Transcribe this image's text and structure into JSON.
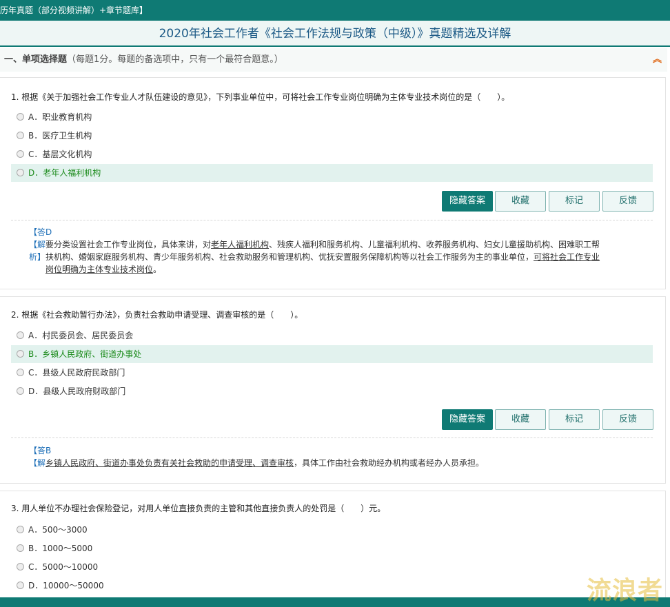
{
  "topbar": {
    "label": "历年真题（部分视频讲解）+章节题库】"
  },
  "page": {
    "title": "2020年社会工作者《社会工作法规与政策（中级）》真题精选及详解"
  },
  "section": {
    "title": "一、单项选择题",
    "desc": "（每题1分。每题的备选项中，只有一个最符合题意。）",
    "collapse_icon": "double-chevron-up-icon",
    "collapse_glyph": "︽"
  },
  "buttons": {
    "hide_answer": "隐藏答案",
    "favorite": "收藏",
    "mark": "标记",
    "feedback": "反馈"
  },
  "questions": [
    {
      "text": "1. 根据《关于加强社会工作专业人才队伍建设的意见》，下列事业单位中，可将社会工作专业岗位明确为主体专业技术岗位的是（　　）。",
      "options": [
        {
          "label": "A．职业教育机构"
        },
        {
          "label": "B．医疗卫生机构"
        },
        {
          "label": "C．基层文化机构"
        },
        {
          "label": "D．老年人福利机构"
        }
      ],
      "answer_label": "【答D",
      "explain_prefix": "【解",
      "explain_line1_a": "要分类设置社会工作专业岗位，具体来讲，对",
      "explain_line1_u": "老年人福利机构",
      "explain_line1_b": "、残疾人福利和服务机构、儿童福利机构、收养服务机构、妇女儿童援助机构、困难职工帮",
      "explain_line2_prefix": "析】",
      "explain_line2_a": "扶机构、婚姻家庭服务机构、青少年服务机构、社会救助服务和管理机构、优抚安置服务保障机构等以社会工作服务为主的事业单位，",
      "explain_line2_u": "可将社会工作专业",
      "explain_line3_u": "岗位明确为主体专业技术岗位",
      "explain_line3_b": "。"
    },
    {
      "text": "2. 根据《社会救助暂行办法》，负责社会救助申请受理、调查审核的是（　　）。",
      "options": [
        {
          "label": "A．村民委员会、居民委员会"
        },
        {
          "label": "B．乡镇人民政府、街道办事处"
        },
        {
          "label": "C．县级人民政府民政部门"
        },
        {
          "label": "D．县级人民政府财政部门"
        }
      ],
      "answer_label": "【答B",
      "explain_prefix": "【解",
      "explain_u": "乡镇人民政府、街道办事处负责有关社会救助的申请受理、调查审核",
      "explain_b": "，具体工作由社会救助经办机构或者经办人员承担。"
    },
    {
      "text": "3. 用人单位不办理社会保险登记，对用人单位直接负责的主管和其他直接负责人的处罚是（　　）元。",
      "options": [
        {
          "label": "A．500～3000"
        },
        {
          "label": "B．1000～5000"
        },
        {
          "label": "C．5000～10000"
        },
        {
          "label": "D．10000～50000"
        }
      ]
    }
  ],
  "watermark": "流浪者"
}
